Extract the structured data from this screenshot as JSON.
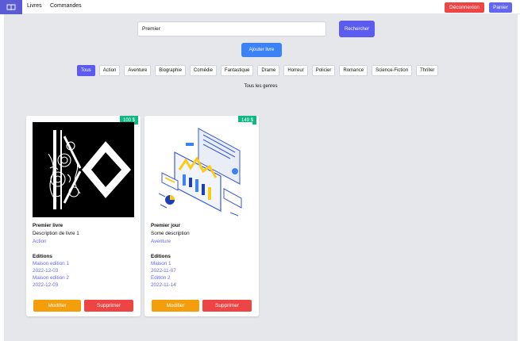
{
  "nav": {
    "links": [
      "Livres",
      "Commandes"
    ],
    "logout_label": "Déconnexion",
    "cart_label": "Panier",
    "logout_color": "#ef4444",
    "cart_color": "#6366f1"
  },
  "search": {
    "value": "Premier",
    "button_label": "Rechercher"
  },
  "add_book_label": "Ajouter livre",
  "genres": [
    "Tous",
    "Action",
    "Aventure",
    "Biographie",
    "Comédie",
    "Fantastique",
    "Drame",
    "Horreur",
    "Policier",
    "Romance",
    "Science-Fiction",
    "Thriller"
  ],
  "active_genre": "Tous",
  "genre_filter_label": "Tous les genres",
  "books": [
    {
      "price": "100 $",
      "title": "Premier livre",
      "description": "Description de livre 1",
      "genre": "Action",
      "editions_label": "Editions",
      "editions": [
        "Maison edition 1",
        "2022-12-03",
        "Maison edition 2",
        "2022-12-03"
      ],
      "edit_label": "Modifier",
      "delete_label": "Supprimer",
      "cover_icon": "letter-k-floral-logo"
    },
    {
      "price": "149 $",
      "title": "Premier jour",
      "description": "Some description",
      "genre": "Aventure",
      "editions_label": "Editions",
      "editions": [
        "Maison 1",
        "2022-11-07",
        "Edition 2",
        "2022-11-14"
      ],
      "edit_label": "Modifier",
      "delete_label": "Supprimer",
      "cover_icon": "isometric-dashboard-illustration"
    }
  ]
}
